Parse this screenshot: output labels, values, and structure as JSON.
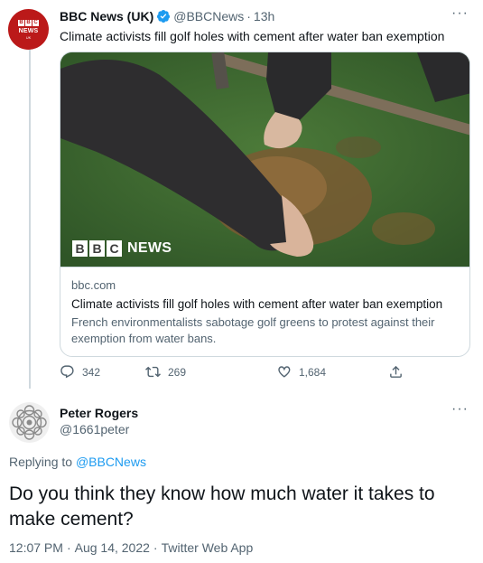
{
  "parent_tweet": {
    "author_name": "BBC News (UK)",
    "handle": "@BBCNews",
    "separator": "·",
    "time": "13h",
    "text": "Climate activists fill golf holes with cement after water ban exemption",
    "avatar_letters": [
      "B",
      "B",
      "C"
    ],
    "avatar_word": "NEWS",
    "avatar_sub": "UK",
    "more": "···",
    "card": {
      "logo_letters": [
        "B",
        "B",
        "C"
      ],
      "logo_word": "NEWS",
      "domain": "bbc.com",
      "title": "Climate activists fill golf holes with cement after water ban exemption",
      "description": "French environmentalists sabotage golf greens to protest against their exemption from water bans."
    },
    "counts": {
      "replies": "342",
      "retweets": "269",
      "likes": "1,684"
    }
  },
  "reply_tweet": {
    "author_name": "Peter Rogers",
    "handle": "@1661peter",
    "more": "···",
    "replying_prefix": "Replying to",
    "replying_to": "@BBCNews",
    "text": "Do you think they know how much water it takes to make cement?",
    "time": "12:07 PM",
    "date": "Aug 14, 2022",
    "source": "Twitter Web App",
    "separator": "·"
  },
  "colors": {
    "accent": "#1d9bf0",
    "bbc_red": "#bb1919",
    "text_primary": "#0f1419",
    "text_secondary": "#536471",
    "border": "#cfd9de"
  },
  "icons": [
    "verified-badge-icon",
    "reply-icon",
    "retweet-icon",
    "like-icon",
    "share-icon",
    "more-icon"
  ]
}
